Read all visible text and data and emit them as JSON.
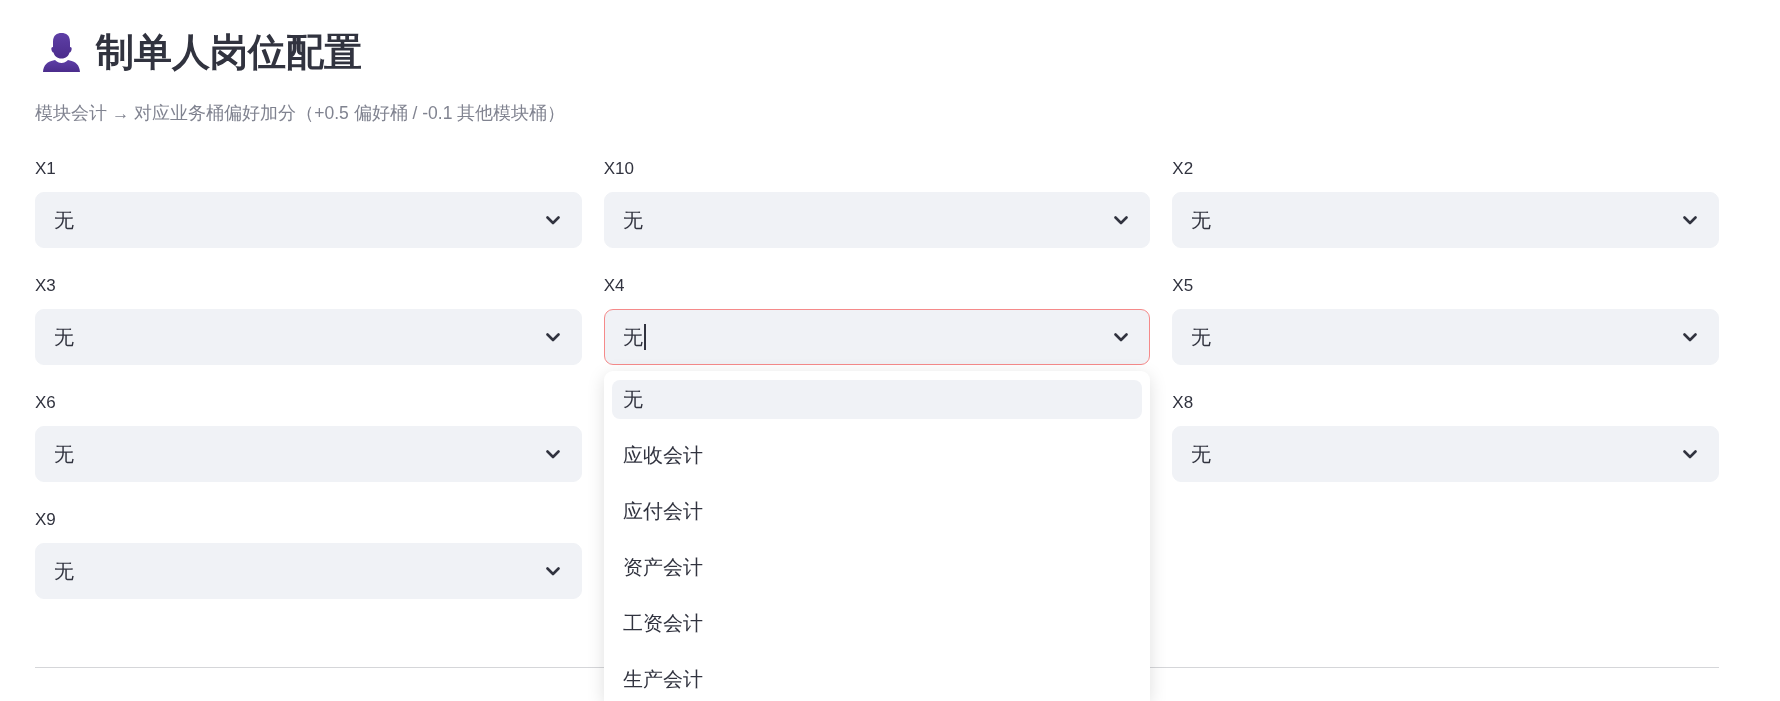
{
  "header": {
    "title": "制单人岗位配置",
    "subtitle": "模块会计 → 对应业务桶偏好加分（+0.5 偏好桶 / -0.1 其他模块桶）"
  },
  "columns": [
    {
      "fields": [
        {
          "label": "X1",
          "value": "无",
          "focused": false
        },
        {
          "label": "X3",
          "value": "无",
          "focused": false
        },
        {
          "label": "X6",
          "value": "无",
          "focused": false
        },
        {
          "label": "X9",
          "value": "无",
          "focused": false
        }
      ]
    },
    {
      "fields": [
        {
          "label": "X10",
          "value": "无",
          "focused": false
        },
        {
          "label": "X4",
          "value": "无",
          "focused": true,
          "options": [
            {
              "label": "无",
              "selected": true
            },
            {
              "label": "应收会计",
              "selected": false
            },
            {
              "label": "应付会计",
              "selected": false
            },
            {
              "label": "资产会计",
              "selected": false
            },
            {
              "label": "工资会计",
              "selected": false
            },
            {
              "label": "生产会计",
              "selected": false
            }
          ]
        }
      ]
    },
    {
      "fields": [
        {
          "label": "X2",
          "value": "无",
          "focused": false
        },
        {
          "label": "X5",
          "value": "无",
          "focused": false
        },
        {
          "label": "X8",
          "value": "无",
          "focused": false
        }
      ]
    }
  ]
}
